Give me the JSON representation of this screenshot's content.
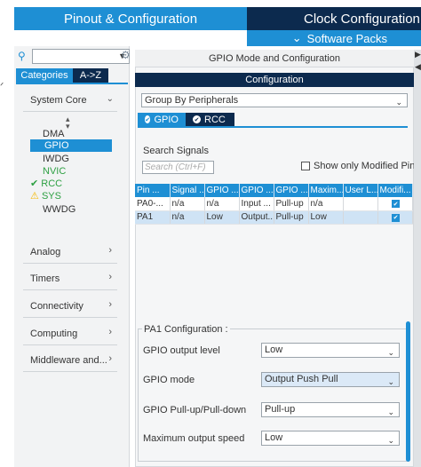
{
  "top_tabs": {
    "pinout": "Pinout & Configuration",
    "clock": "Clock Configuration",
    "software_packs": "Software Packs",
    "software_packs_icon": "chevron-down-icon"
  },
  "left": {
    "search_value": "",
    "tabs": {
      "categories": "Categories",
      "az": "A->Z"
    },
    "system_core": "System Core",
    "peripherals": [
      {
        "label": "DMA",
        "status": "none"
      },
      {
        "label": "GPIO",
        "status": "selected"
      },
      {
        "label": "IWDG",
        "status": "none"
      },
      {
        "label": "NVIC",
        "status": "configured"
      },
      {
        "label": "RCC",
        "status": "ok"
      },
      {
        "label": "SYS",
        "status": "warning"
      },
      {
        "label": "WWDG",
        "status": "none"
      }
    ],
    "categories": [
      "Analog",
      "Timers",
      "Connectivity",
      "Computing",
      "Middleware and..."
    ]
  },
  "right": {
    "mode_title": "GPIO Mode and Configuration",
    "config_bar": "Configuration",
    "group_select": "Group By Peripherals",
    "subtabs": [
      "GPIO",
      "RCC"
    ],
    "search_signals_label": "Search Signals",
    "search_placeholder": "Search (Ctrl+F)",
    "show_modified_label": "Show only Modified Pins",
    "table": {
      "headers": [
        "Pin ...",
        "Signal ...",
        "GPIO ...",
        "GPIO ...",
        "GPIO ...",
        "Maxim...",
        "User L...",
        "Modifi..."
      ],
      "rows": [
        [
          "PA0-...",
          "n/a",
          "n/a",
          "Input ...",
          "Pull-up",
          "n/a",
          "",
          "checked"
        ],
        [
          "PA1",
          "n/a",
          "Low",
          "Output...",
          "Pull-up",
          "Low",
          "",
          "checked"
        ]
      ],
      "selected_row": 1
    },
    "pa1": {
      "title": "PA1 Configuration :",
      "fields": [
        {
          "label": "GPIO output level",
          "value": "Low"
        },
        {
          "label": "GPIO mode",
          "value": "Output Push Pull"
        },
        {
          "label": "GPIO Pull-up/Pull-down",
          "value": "Pull-up"
        },
        {
          "label": "Maximum output speed",
          "value": "Low"
        }
      ]
    }
  },
  "colors": {
    "primary": "#1e8fd4",
    "dark": "#0c2a4e",
    "ok_green": "#2ea043",
    "warning_yellow": "#f5b800"
  }
}
